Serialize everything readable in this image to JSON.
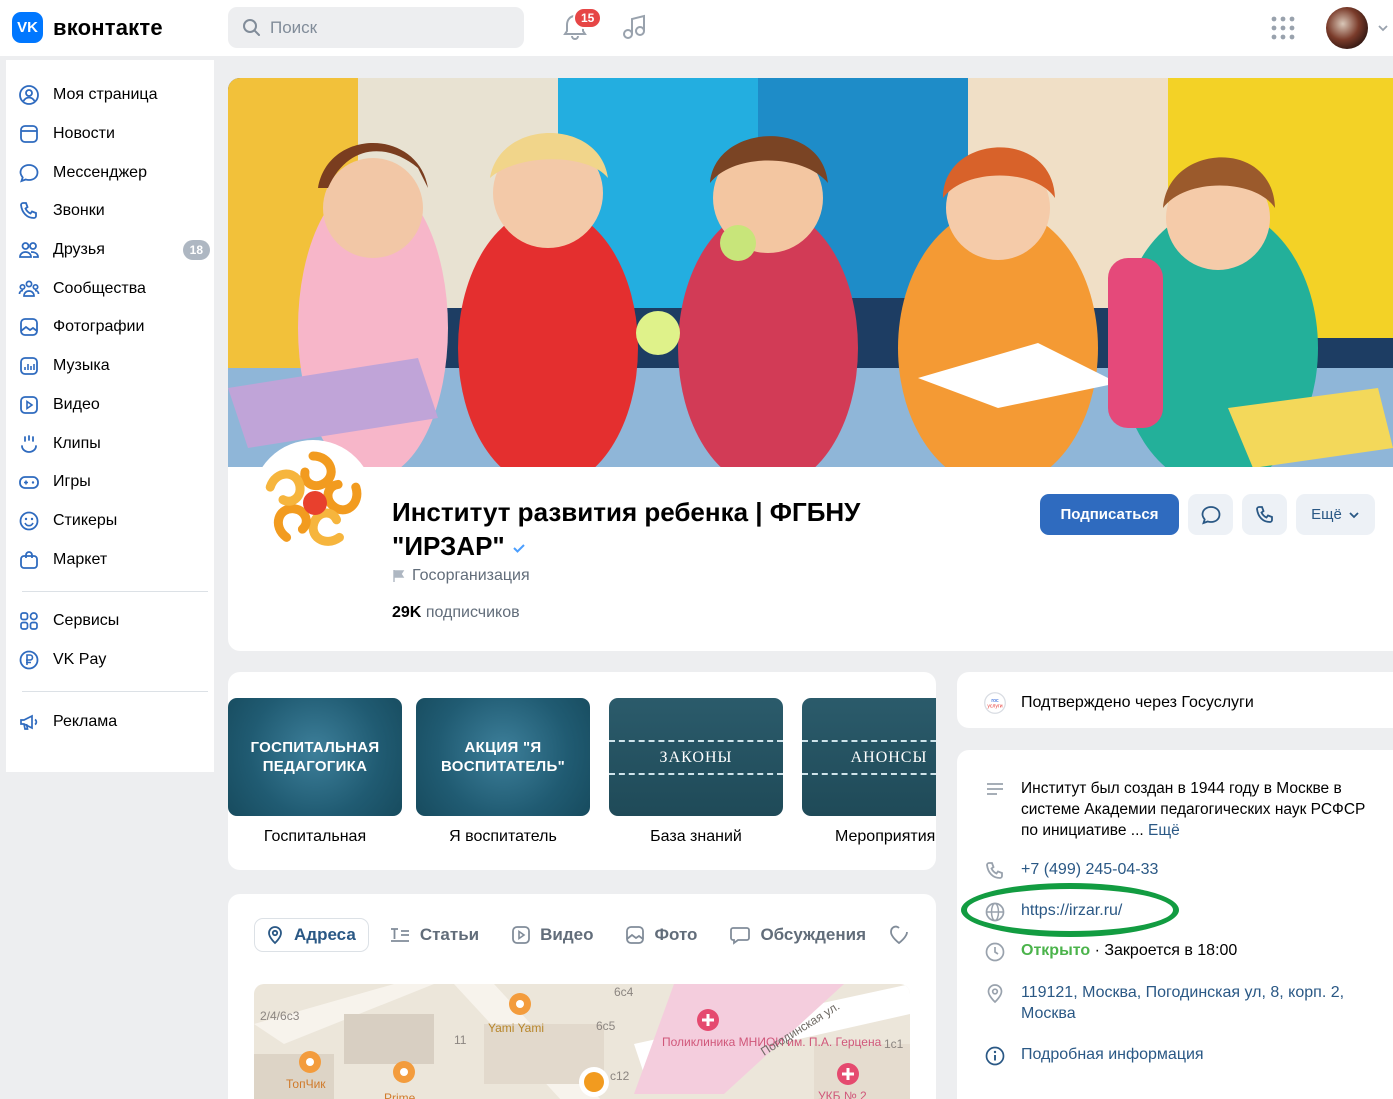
{
  "header": {
    "logo_text": "вконтакте",
    "search_placeholder": "Поиск",
    "notifications_count": "15"
  },
  "sidebar": {
    "items": [
      {
        "label": "Моя страница"
      },
      {
        "label": "Новости"
      },
      {
        "label": "Мессенджер"
      },
      {
        "label": "Звонки"
      },
      {
        "label": "Друзья",
        "badge": "18"
      },
      {
        "label": "Сообщества"
      },
      {
        "label": "Фотографии"
      },
      {
        "label": "Музыка"
      },
      {
        "label": "Видео"
      },
      {
        "label": "Клипы"
      },
      {
        "label": "Игры"
      },
      {
        "label": "Стикеры"
      },
      {
        "label": "Маркет"
      }
    ],
    "extra": [
      {
        "label": "Сервисы"
      },
      {
        "label": "VK Pay"
      }
    ],
    "ads": {
      "label": "Реклама"
    }
  },
  "group": {
    "title": "Институт развития ребенка | ФГБНУ \"ИРЗАР\"",
    "type": "Госорганизация",
    "subscribers_count": "29K",
    "subscribers_word": "подписчиков",
    "subscribe_label": "Подписаться",
    "more_label": "Ещё"
  },
  "tiles": [
    {
      "image_text": "ГОСПИТАЛЬНАЯ ПЕДАГОГИКА",
      "label": "Госпитальная"
    },
    {
      "image_text": "АКЦИЯ \"Я ВОСПИТАТЕЛЬ\"",
      "label": "Я воспитатель"
    },
    {
      "image_text": "ЗАКОНЫ",
      "label": "База знаний"
    },
    {
      "image_text": "АНОНСЫ",
      "label": "Мероприятия"
    }
  ],
  "tabs": [
    {
      "label": "Адреса",
      "active": true
    },
    {
      "label": "Статьи"
    },
    {
      "label": "Видео"
    },
    {
      "label": "Фото"
    },
    {
      "label": "Обсуждения"
    }
  ],
  "map": {
    "labels": [
      "2/4/6с3",
      "ТопЧик",
      "Yami Yami",
      "11",
      "6с5",
      "6с4",
      "с12",
      "Поликлиника МНИОИ им. П.А. Герцена",
      "Погодинская ул.",
      "1с1",
      "УКБ № 2",
      "Prime"
    ]
  },
  "info": {
    "gosuslugi": "Подтверждено через Госуслуги",
    "description": "Институт был создан в 1944 году в Москве в системе Академии педагогических наук РСФСР по инициативе ...",
    "more_link": "Ещё",
    "phone": "+7 (499) 245-04-33",
    "website": "https://irzar.ru/",
    "open_status": "Открыто",
    "hours": "· Закроется в 18:00",
    "address": "119121, Москва, Погодинская ул, 8, корп. 2, Москва",
    "details": "Подробная информация"
  },
  "colors": {
    "accent": "#2f6bbf",
    "link": "#2a5885",
    "highlight_oval": "#129c41",
    "open_green": "#4bb34b",
    "badge_red": "#e64646"
  }
}
